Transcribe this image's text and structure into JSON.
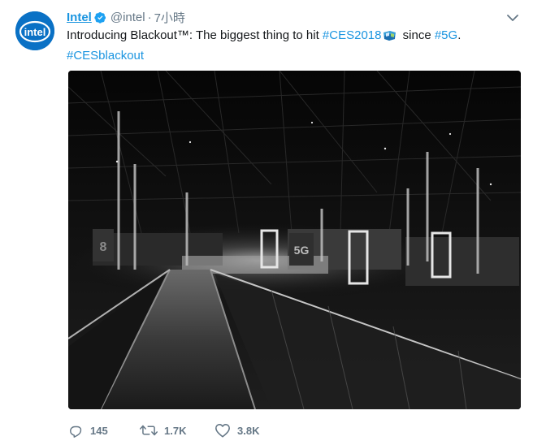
{
  "tweet": {
    "author_name": "Intel",
    "handle": "@intel",
    "separator": "·",
    "time": "7小時",
    "avatar_logo_text": "intel",
    "text_parts": {
      "intro": "Introducing Blackout™: The biggest thing to hit ",
      "hashtag1": "#CES2018",
      "middle": " since ",
      "hashtag2": "#5G",
      "end": ".",
      "hashtag3": "#CESblackout"
    },
    "media_signage": [
      "8",
      "5G"
    ]
  },
  "actions": {
    "reply_count": "145",
    "retweet_count": "1.7K",
    "like_count": "3.8K"
  },
  "icons": {
    "verified": "verified-badge-icon",
    "more": "chevron-down-icon",
    "reply": "reply-icon",
    "retweet": "retweet-icon",
    "like": "heart-icon",
    "emoji": "ces-flag-emoji-icon"
  },
  "colors": {
    "link": "#1b95e0",
    "text": "#14171a",
    "muted": "#657786",
    "intel_blue": "#0a71c5"
  }
}
